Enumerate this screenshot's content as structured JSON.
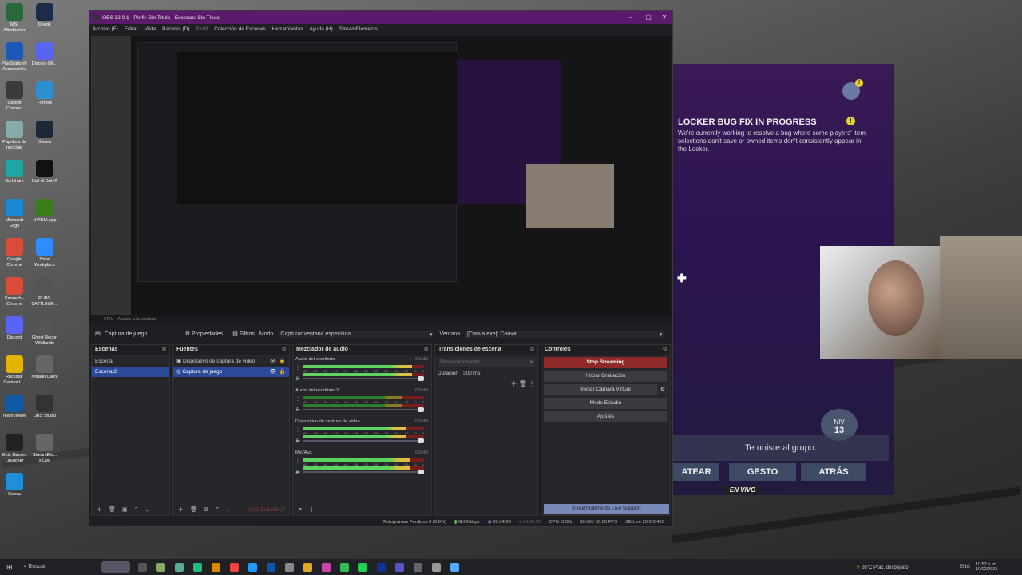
{
  "desktop": {
    "icons": [
      {
        "label": "MSI Afterburner",
        "color": "#2a6a3a"
      },
      {
        "label": "DeepL",
        "color": "#1b2c49"
      },
      {
        "label": "PlayStation® Accessories",
        "color": "#1c58b8"
      },
      {
        "label": "Discord-DE...",
        "color": "#5865f2"
      },
      {
        "label": "Ubisoft Connect",
        "color": "#3a3a3a"
      },
      {
        "label": "Fortnite",
        "color": "#2c8fd0"
      },
      {
        "label": "Papelera de reciclaje",
        "color": "#8aa"
      },
      {
        "label": "Steam",
        "color": "#1b2838"
      },
      {
        "label": "Surfshark",
        "color": "#1ea7a2"
      },
      {
        "label": "Call of Duty®",
        "color": "#111"
      },
      {
        "label": "Microsoft Edge",
        "color": "#1a8ad4"
      },
      {
        "label": "NVIDIA App",
        "color": "#3a7d1a"
      },
      {
        "label": "Google Chrome",
        "color": "#d94c3a"
      },
      {
        "label": "Zoom Workplace",
        "color": "#2d8cff"
      },
      {
        "label": "Kenneth - Chrome",
        "color": "#d94c3a"
      },
      {
        "label": "PUBG BATTLEGR...",
        "color": "#555"
      },
      {
        "label": "Discord",
        "color": "#5865f2"
      },
      {
        "label": "Ghost Recon Wildlands",
        "color": "#555"
      },
      {
        "label": "Rockstar Games L...",
        "color": "#e0b400"
      },
      {
        "label": "Nitrado Client",
        "color": "#666"
      },
      {
        "label": "TeamViewer",
        "color": "#0e5aa7"
      },
      {
        "label": "OBS Studio",
        "color": "#333"
      },
      {
        "label": "Epic Games Launcher",
        "color": "#222"
      },
      {
        "label": "StreamEle... s Live",
        "color": "#666"
      },
      {
        "label": "Canva",
        "color": "#1e8fd8"
      }
    ]
  },
  "obs": {
    "title": "OBS 32.0.1 - Perfil: Sin Título - Escenas: Sin Título",
    "menu": [
      "Archivo (F)",
      "Editar",
      "Vista",
      "Paneles (D)",
      "Perfil",
      "Colección de Escenas",
      "Herramientas",
      "Ayuda (H)",
      "StreamElements"
    ],
    "zoom_label": "67%",
    "fit_label": "Ajustar a la ventana",
    "source_bar": {
      "source_name": "Captura de juego",
      "properties": "Propiedades",
      "filters": "Filtros",
      "mode_label": "Modo",
      "mode_value": "Capturar ventana específica",
      "window_label": "Ventana",
      "window_value": "[Canva.exe]: Canva"
    },
    "scenes": {
      "title": "Escenas",
      "items": [
        "Escena",
        "Escena 2"
      ],
      "selected": 1
    },
    "sources": {
      "title": "Fuentes",
      "items": [
        "Dispositivo de captura de video",
        "Captura de juego"
      ],
      "selected": 1,
      "add_element": "ADD ELEMENT"
    },
    "mixer": {
      "title": "Mezclador de audio",
      "channels": [
        {
          "name": "Audio del escritorio",
          "db": "0.0 dB",
          "level": 0.9
        },
        {
          "name": "Audio del escritorio 2",
          "db": "0.0 dB",
          "level": 0.0
        },
        {
          "name": "Dispositivo de captura de video",
          "db": "0.0 dB",
          "level": 0.85
        },
        {
          "name": "Mic/Aux",
          "db": "0.0 dB",
          "level": 0.88
        }
      ],
      "ticks": [
        "-60",
        "-55",
        "-50",
        "-45",
        "-40",
        "-35",
        "-30",
        "-25",
        "-20",
        "-15",
        "-10",
        "-5",
        "0"
      ]
    },
    "transitions": {
      "title": "Transiciones de escena",
      "value": "Desvanecimiento",
      "duration_label": "Duración",
      "duration_value": "300 ms"
    },
    "controls": {
      "title": "Controles",
      "buttons": [
        "Stop Streaming",
        "Iniciar Grabación",
        "Iniciar Cámara Virtual",
        "Modo Estudio",
        "Ajustes"
      ],
      "support": "StreamElements Live Support"
    },
    "status": {
      "dropped": "Fotogramas Perdidos 0 (0.0%)",
      "bitrate": "6160 kbps",
      "stream_time": "00:34:08",
      "rec_time": "00:00:00",
      "cpu": "CPU: 3.5%",
      "fps": "60.00 / 60.00 FPS",
      "version": "SE.Live 25.0.3.493"
    }
  },
  "fortnite": {
    "notice_title": "LOCKER BUG FIX IN PROGRESS",
    "notice_body": "We're currently working to resolve a bug where some players' item selections don't save or owned items don't consistently appear in the Locker.",
    "level_label": "NIV",
    "level_value": "13",
    "joined": "Te uniste al grupo.",
    "buttons": [
      "ATEAR",
      "GESTO",
      "ATRÁS"
    ],
    "live_badge": "EN VIVO"
  },
  "taskbar": {
    "search": "Buscar",
    "weather": "26°C Prac. despejado",
    "lang": "ENG",
    "time": "10:52 p. m.",
    "date": "10/02/2025"
  }
}
